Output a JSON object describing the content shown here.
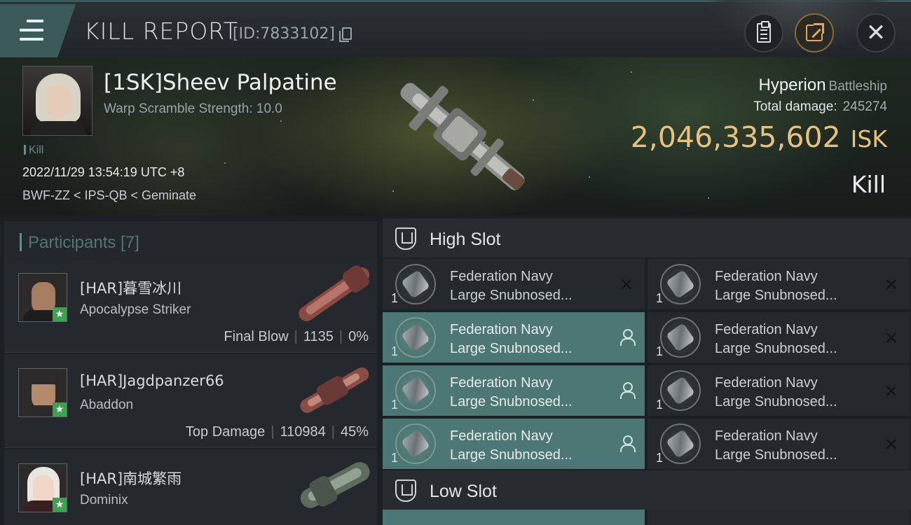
{
  "header": {
    "title": "KILL REPORT",
    "report_id": "[ID:7833102]",
    "icons": [
      "menu-icon",
      "copy-icon",
      "clipboard-icon",
      "share-icon",
      "close-icon"
    ]
  },
  "victim": {
    "pilot": "[1SK]Sheev Palpatine",
    "warp_scramble": "Warp Scramble Strength: 10.0",
    "tag": "Kill",
    "datetime": "2022/11/29 13:54:19 UTC +8",
    "location": "BWF-ZZ < IPS-QB < Geminate",
    "ship": "Hyperion",
    "ship_class": "Battleship",
    "total_damage_label": "Total damage:",
    "total_damage": "245274",
    "isk_value": "2,046,335,602",
    "isk_unit": "ISK",
    "result": "Kill"
  },
  "participants": {
    "label": "Participants [7]",
    "rows": [
      {
        "name": "[HAR]暮雪冰川",
        "ship": "Apocalypse Striker",
        "role": "Final Blow",
        "damage": "1135",
        "percent": "0%"
      },
      {
        "name": "[HAR]Jagdpanzer66",
        "ship": "Abaddon",
        "role": "Top Damage",
        "damage": "110984",
        "percent": "45%"
      },
      {
        "name": "[HAR]南城繁雨",
        "ship": "Dominix"
      }
    ]
  },
  "fitting": {
    "high_slot_label": "High Slot",
    "low_slot_label": "Low Slot",
    "module_name_line1": "Federation Navy",
    "module_name_line2": "Large Snubnosed...",
    "quantity": "1",
    "destroyed_symbol": "✕",
    "colors": {
      "active": "#4d7774",
      "inactive": "#25292e",
      "isk": "#e6c27d",
      "accent": "#5e8f8d"
    }
  }
}
